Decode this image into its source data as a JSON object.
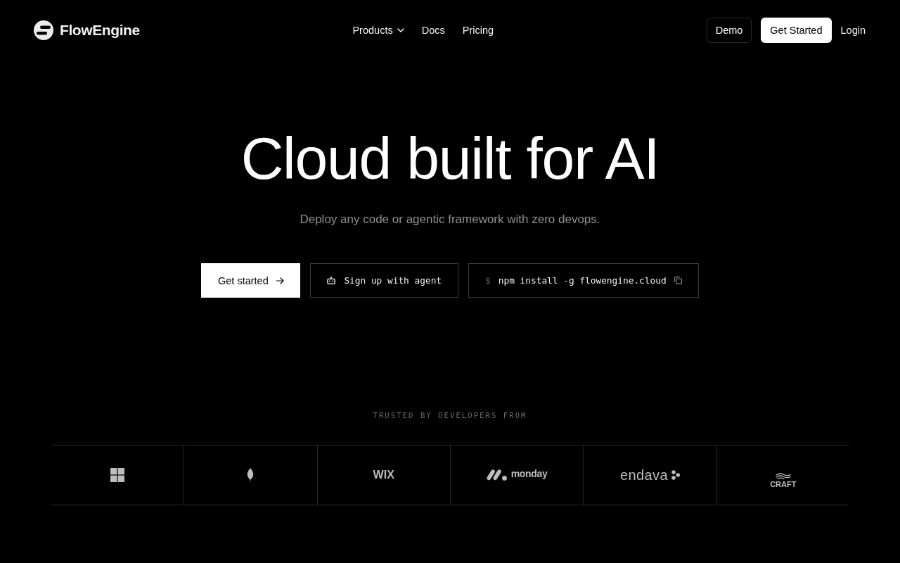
{
  "header": {
    "brand": "FlowEngine",
    "nav": [
      {
        "label": "Products",
        "has_menu": true
      },
      {
        "label": "Docs",
        "has_menu": false
      },
      {
        "label": "Pricing",
        "has_menu": false
      }
    ],
    "actions": [
      {
        "kind": "outline",
        "label": "Demo"
      },
      {
        "kind": "solid",
        "label": "Get Started"
      },
      {
        "kind": "text",
        "label": "Login"
      }
    ]
  },
  "hero": {
    "title": "Cloud built for AI",
    "subtitle": "Deploy any code or agentic framework with zero devops.",
    "cta": [
      {
        "kind": "primary",
        "label": "Get started"
      },
      {
        "kind": "agent",
        "label": "Sign up with agent"
      },
      {
        "kind": "command",
        "prompt": "$",
        "label": "npm install -g flowengine.cloud"
      }
    ]
  },
  "trusted": {
    "heading": "TRUSTED BY DEVELOPERS FROM",
    "logos": [
      {
        "kind": "grid"
      },
      {
        "kind": "leaf"
      },
      {
        "kind": "wordmark",
        "text": "WIX"
      },
      {
        "kind": "pills",
        "text": "monday"
      },
      {
        "kind": "dots",
        "text": "endava"
      },
      {
        "kind": "waves",
        "text": "CRAFT"
      }
    ]
  }
}
